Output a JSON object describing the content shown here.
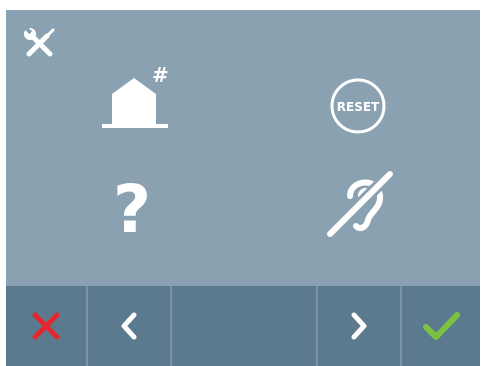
{
  "colors": {
    "panel": "#8aa1b1",
    "toolbar": "#5b7a8d",
    "separator": "#7894a6",
    "icon": "#ffffff",
    "cancel": "#e2282e",
    "confirm": "#7cc242"
  },
  "settings": {
    "corner_icon": "tools-icon",
    "home_icon": "house-hash-icon",
    "home_badge": "#",
    "reset_icon": "reset-icon",
    "reset_label": "RESET",
    "help_icon": "question-mark-icon",
    "help_label": "?",
    "hearing_icon": "hearing-loop-icon"
  },
  "toolbar": {
    "cancel_icon": "close-icon",
    "prev_icon": "chevron-left-icon",
    "next_icon": "chevron-right-icon",
    "confirm_icon": "checkmark-icon"
  }
}
